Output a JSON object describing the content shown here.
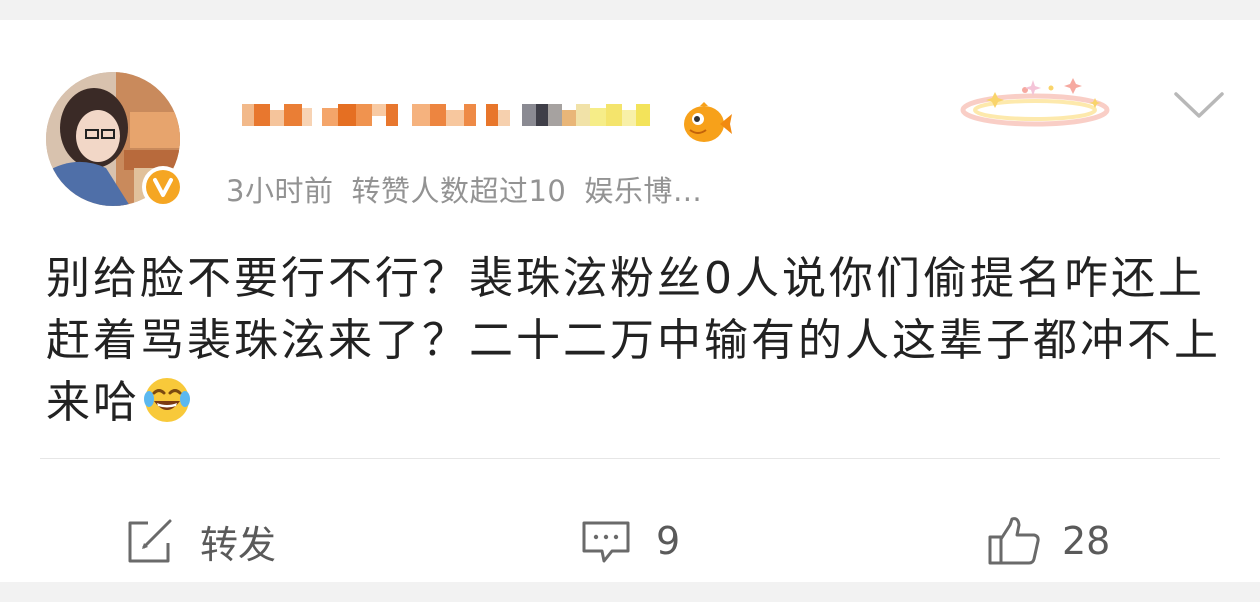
{
  "post": {
    "meta": {
      "time": "3小时前",
      "repost_info": "转赞人数超过10",
      "category": "娱乐博…"
    },
    "text": "别给脸不要行不行？裴珠泫粉丝0人说你们偷提名咋还上赶着骂裴珠泫来了？二十二万中输有的人这辈子都冲不上来哈",
    "emoji": "laugh-cry"
  },
  "actions": {
    "repost_label": "转发",
    "comment_count": "9",
    "like_count": "28"
  },
  "colors": {
    "verified_badge": "#f5a623",
    "meta_text": "#939393",
    "body_text": "#222222",
    "action_text": "#5a5a5a"
  }
}
